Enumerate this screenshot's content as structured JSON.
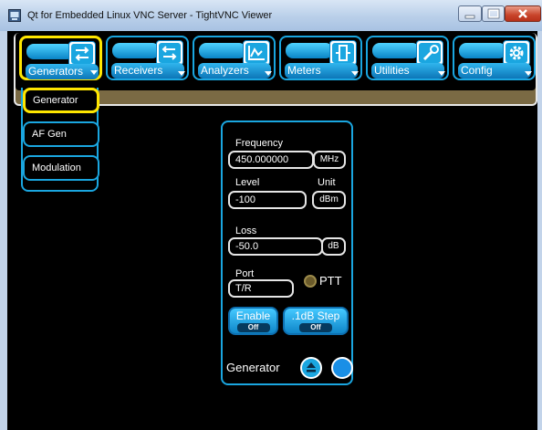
{
  "window": {
    "title": "Qt for Embedded Linux VNC Server - TightVNC Viewer"
  },
  "tabs": [
    {
      "label": "Generators",
      "icon": "generators-icon",
      "selected": true
    },
    {
      "label": "Receivers",
      "icon": "receivers-icon",
      "selected": false
    },
    {
      "label": "Analyzers",
      "icon": "analyzers-icon",
      "selected": false
    },
    {
      "label": "Meters",
      "icon": "meters-icon",
      "selected": false
    },
    {
      "label": "Utilities",
      "icon": "wrench-icon",
      "selected": false
    },
    {
      "label": "Config",
      "icon": "gear-icon",
      "selected": false
    }
  ],
  "submenu": [
    {
      "label": "Generator",
      "selected": true
    },
    {
      "label": "AF Gen",
      "selected": false
    },
    {
      "label": "Modulation",
      "selected": false
    }
  ],
  "panel": {
    "frequency": {
      "label": "Frequency",
      "value": "450.000000",
      "unit": "MHz"
    },
    "level": {
      "label": "Level",
      "value": "-100",
      "unit_label": "Unit",
      "unit": "dBm"
    },
    "loss": {
      "label": "Loss",
      "value": "-50.0",
      "unit": "dB"
    },
    "port": {
      "label": "Port",
      "value": "T/R"
    },
    "ptt": {
      "label": "PTT"
    },
    "enable": {
      "label": "Enable",
      "state": "Off"
    },
    "step": {
      "label": ".1dB Step",
      "state": "Off"
    },
    "footer": {
      "label": "Generator"
    }
  },
  "colors": {
    "accent": "#1aa6e0",
    "selected": "#ffe600",
    "screen": "#000000"
  }
}
